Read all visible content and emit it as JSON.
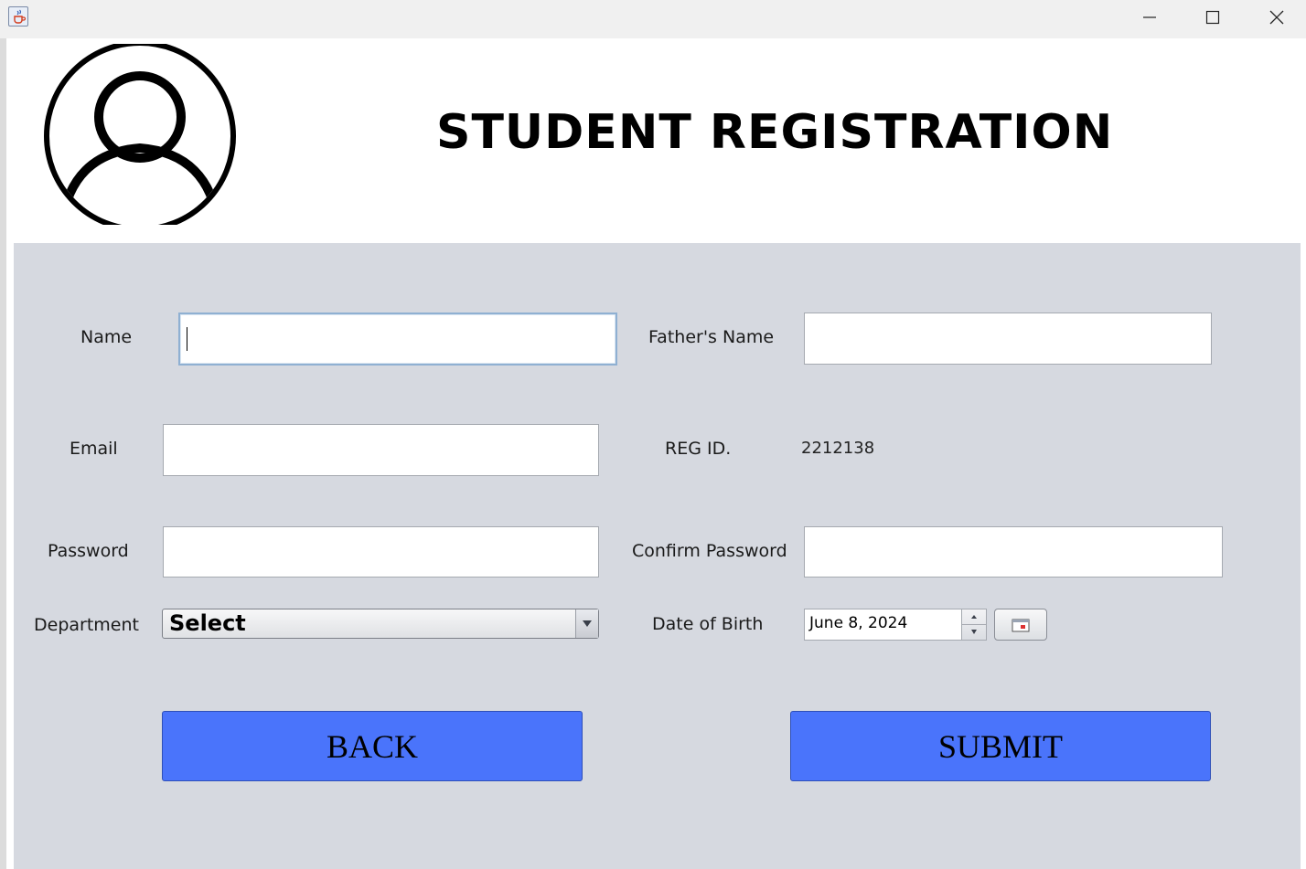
{
  "window": {
    "icon": "java-cup-icon",
    "controls": [
      "minimize-icon",
      "maximize-icon",
      "close-icon"
    ]
  },
  "header": {
    "avatar_icon": "user-avatar-icon",
    "title": "STUDENT REGISTRATION"
  },
  "form": {
    "name_label": "Name",
    "name_value": "",
    "fathers_name_label": "Father's Name",
    "fathers_name_value": "",
    "email_label": "Email",
    "email_value": "",
    "reg_id_label": "REG ID.",
    "reg_id_value": "2212138",
    "password_label": "Password",
    "password_value": "",
    "confirm_password_label": "Confirm Password",
    "confirm_password_value": "",
    "department_label": "Department",
    "department_selected": "Select",
    "dob_label": "Date of Birth",
    "dob_value": "June 8, 2024",
    "calendar_icon": "calendar-icon"
  },
  "buttons": {
    "back_label": "BACK",
    "submit_label": "SUBMIT"
  },
  "colors": {
    "panel_bg": "#d6d9e0",
    "button_bg": "#4a74fb"
  }
}
